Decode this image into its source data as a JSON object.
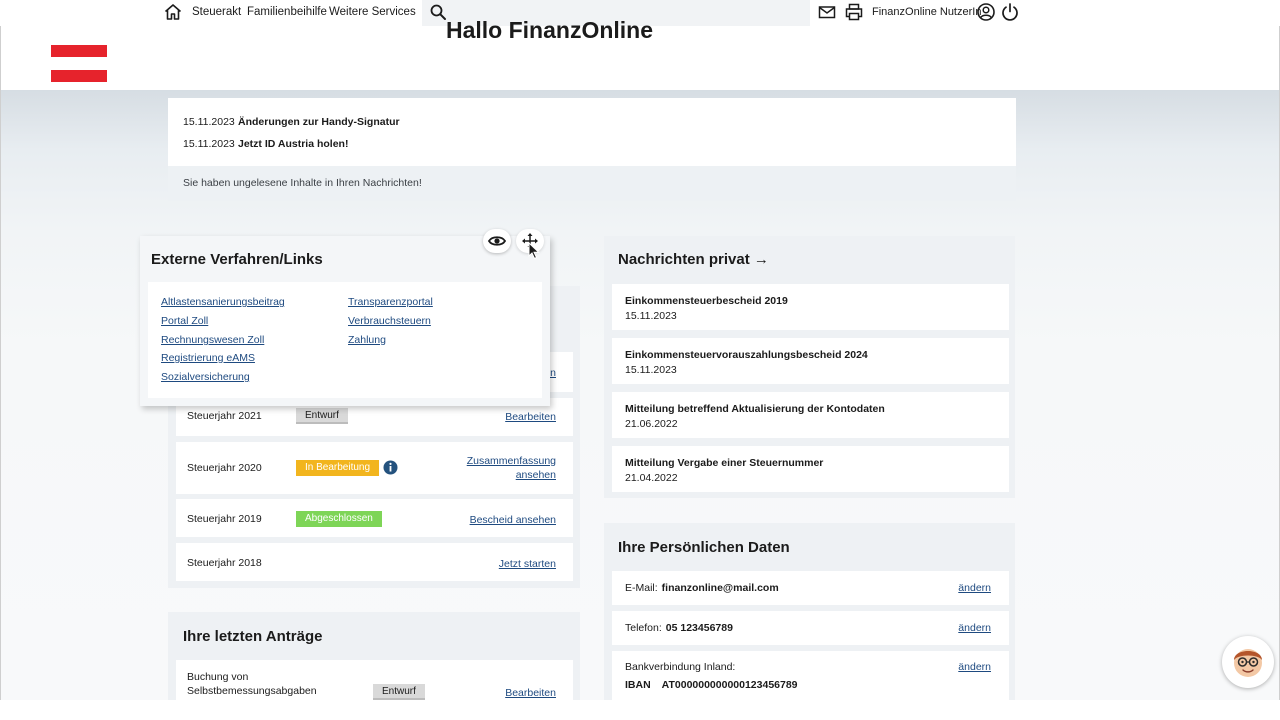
{
  "topbar": {
    "nav": [
      "Steuerakt",
      "Familienbeihilfe",
      "Weitere Services"
    ],
    "user_label": "FinanzOnline NutzerIn",
    "icons": [
      "home-icon",
      "search-icon",
      "mail-icon",
      "printer-icon",
      "user-icon",
      "power-icon"
    ]
  },
  "header": {
    "greeting": "Hallo FinanzOnline NutzerIn!"
  },
  "news": {
    "items": [
      {
        "date": "15.11.2023",
        "title": "Änderungen zur Handy-Signatur"
      },
      {
        "date": "15.11.2023",
        "title": "Jetzt ID Austria holen!"
      }
    ],
    "footer": "Sie haben ungelesene Inhalte in Ihren Nachrichten!"
  },
  "external_links": {
    "title": "Externe Verfahren/Links",
    "col1": [
      "Altlastensanierungsbeitrag",
      "Portal Zoll",
      "Rechnungswesen Zoll",
      "Registrierung eAMS",
      "Sozialversicherung"
    ],
    "col2": [
      "Transparenzportal",
      "Verbrauchsteuern",
      "Zahlung"
    ]
  },
  "tax_years": {
    "hidden_link_fragment": "en",
    "rows": [
      {
        "year": "Steuerjahr 2021",
        "status": "Entwurf",
        "link": "Bearbeiten"
      },
      {
        "year": "Steuerjahr 2020",
        "status": "In Bearbeitung",
        "link_line1": "Zusammenfassung",
        "link_line2": "ansehen"
      },
      {
        "year": "Steuerjahr 2019",
        "status": "Abgeschlossen",
        "link": "Bescheid ansehen"
      },
      {
        "year": "Steuerjahr 2018",
        "link": "Jetzt starten"
      }
    ]
  },
  "applications": {
    "title": "Ihre letzten Anträge",
    "row": {
      "label_line1": "Buchung von",
      "label_line2": "Selbstbemessungsabgaben",
      "status": "Entwurf",
      "link": "Bearbeiten"
    }
  },
  "messages": {
    "title": "Nachrichten privat",
    "arrow": "→",
    "items": [
      {
        "title": "Einkommensteuerbescheid 2019",
        "date": "15.11.2023"
      },
      {
        "title": "Einkommensteuervorauszahlungsbescheid 2024",
        "date": "15.11.2023"
      },
      {
        "title": "Mitteilung betreffend Aktualisierung der Kontodaten",
        "date": "21.06.2022"
      },
      {
        "title": "Mitteilung Vergabe einer Steuernummer",
        "date": "21.04.2022"
      }
    ]
  },
  "personal_data": {
    "title": "Ihre Persönlichen Daten",
    "email_label": "E-Mail:",
    "email_value": "finanzonline@mail.com",
    "phone_label": "Telefon:",
    "phone_value": "05 123456789",
    "bank_label": "Bankverbindung Inland:",
    "iban_label": "IBAN",
    "iban_value": "AT000000000000123456789",
    "change_link": "ändern"
  },
  "colors": {
    "accent_red": "#e6232c",
    "link_blue": "#1e4a80",
    "status_orange": "#f2b51e",
    "status_green": "#7ed557",
    "status_gray": "#d9d9d9"
  }
}
